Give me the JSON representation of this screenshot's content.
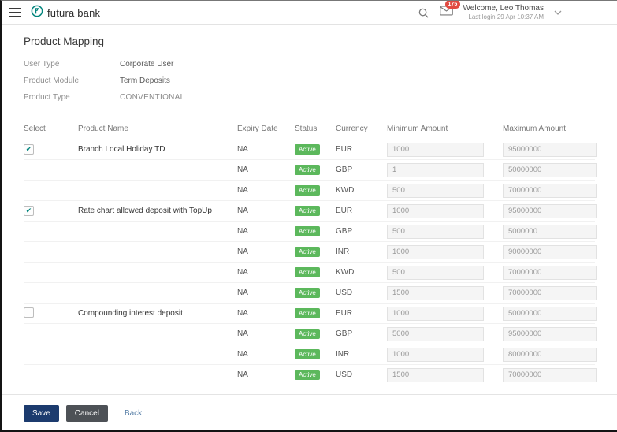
{
  "colors": {
    "brand": "#00847c",
    "active_badge": "#5cb85c",
    "save_button": "#1c3b6e",
    "cancel_button": "#4d5156",
    "back_link": "#557da6",
    "mail_badge": "#e14b42",
    "check": "#00847c"
  },
  "header": {
    "brand_name": "futura bank",
    "mail_count": "175",
    "welcome": "Welcome, Leo Thomas",
    "last_login": "Last login 29 Apr 10:37 AM"
  },
  "page_title": "Product Mapping",
  "info": {
    "fields": [
      {
        "label": "User Type",
        "value": "Corporate User"
      },
      {
        "label": "Product Module",
        "value": "Term Deposits"
      },
      {
        "label": "Product Type",
        "value": "CONVENTIONAL"
      }
    ]
  },
  "table": {
    "headers": [
      "Select",
      "Product Name",
      "Expiry Date",
      "Status",
      "Currency",
      "Minimum Amount",
      "Maximum Amount"
    ],
    "rows": [
      {
        "select": "checked",
        "product": "Branch Local Holiday TD",
        "expiry": "NA",
        "status": "Active",
        "currency": "EUR",
        "min": "1000",
        "max": "95000000"
      },
      {
        "select": "none",
        "product": "",
        "expiry": "NA",
        "status": "Active",
        "currency": "GBP",
        "min": "1",
        "max": "50000000"
      },
      {
        "select": "none",
        "product": "",
        "expiry": "NA",
        "status": "Active",
        "currency": "KWD",
        "min": "500",
        "max": "70000000"
      },
      {
        "select": "checked",
        "product": "Rate chart allowed deposit with TopUp",
        "expiry": "NA",
        "status": "Active",
        "currency": "EUR",
        "min": "1000",
        "max": "95000000"
      },
      {
        "select": "none",
        "product": "",
        "expiry": "NA",
        "status": "Active",
        "currency": "GBP",
        "min": "500",
        "max": "5000000"
      },
      {
        "select": "none",
        "product": "",
        "expiry": "NA",
        "status": "Active",
        "currency": "INR",
        "min": "1000",
        "max": "90000000"
      },
      {
        "select": "none",
        "product": "",
        "expiry": "NA",
        "status": "Active",
        "currency": "KWD",
        "min": "500",
        "max": "70000000"
      },
      {
        "select": "none",
        "product": "",
        "expiry": "NA",
        "status": "Active",
        "currency": "USD",
        "min": "1500",
        "max": "70000000"
      },
      {
        "select": "unchecked",
        "product": "Compounding interest deposit",
        "expiry": "NA",
        "status": "Active",
        "currency": "EUR",
        "min": "1000",
        "max": "50000000"
      },
      {
        "select": "none",
        "product": "",
        "expiry": "NA",
        "status": "Active",
        "currency": "GBP",
        "min": "5000",
        "max": "95000000"
      },
      {
        "select": "none",
        "product": "",
        "expiry": "NA",
        "status": "Active",
        "currency": "INR",
        "min": "1000",
        "max": "80000000"
      },
      {
        "select": "none",
        "product": "",
        "expiry": "NA",
        "status": "Active",
        "currency": "USD",
        "min": "1500",
        "max": "70000000"
      }
    ]
  },
  "footer": {
    "save_label": "Save",
    "cancel_label": "Cancel",
    "back_label": "Back"
  }
}
